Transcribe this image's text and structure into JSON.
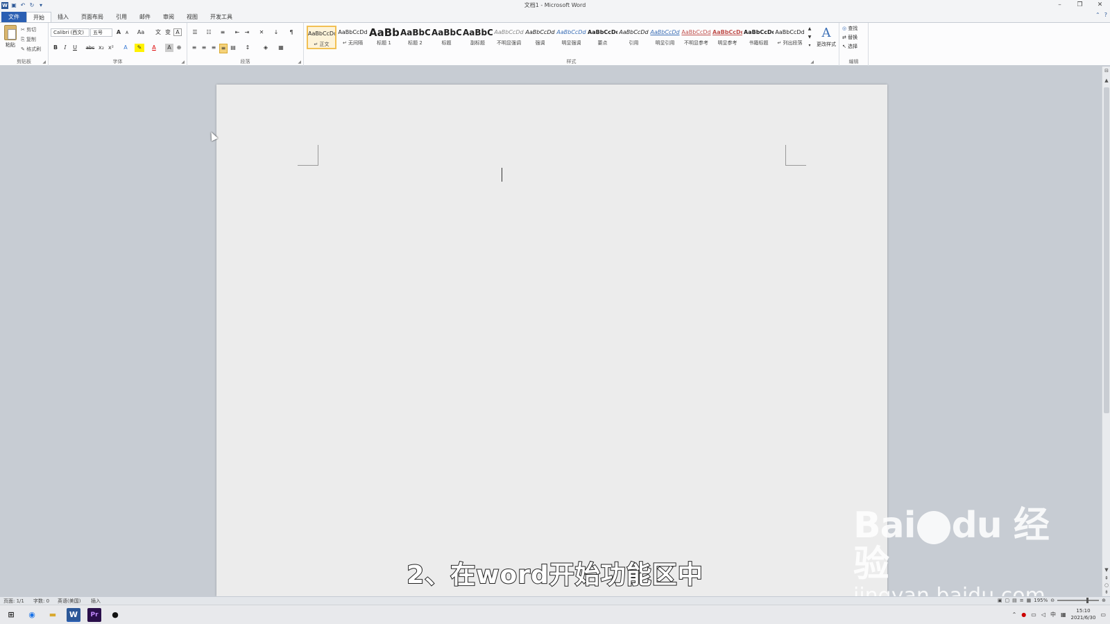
{
  "window": {
    "title": "文档1 - Microsoft Word",
    "minimize": "–",
    "restore": "❐",
    "close": "✕"
  },
  "qat": {
    "word_icon": "W",
    "save_icon": "save-icon",
    "undo_icon": "undo-icon",
    "redo_icon": "redo-icon"
  },
  "tabs": [
    "文件",
    "开始",
    "插入",
    "页面布局",
    "引用",
    "邮件",
    "审阅",
    "视图",
    "开发工具"
  ],
  "clipboard": {
    "paste": "粘贴",
    "cut": "剪切",
    "copy": "复制",
    "painter": "格式刷",
    "label": "剪贴板"
  },
  "font": {
    "name": "Calibri (西文)",
    "size": "五号",
    "bold": "B",
    "italic": "I",
    "underline": "U",
    "strike": "abc",
    "sub": "x₂",
    "sup": "x²",
    "grow": "A",
    "shrink": "A",
    "case": "Aa",
    "label": "字体"
  },
  "paragraph": {
    "label": "段落"
  },
  "styles": {
    "label": "样式",
    "items": [
      {
        "preview": "AaBbCcDd",
        "name": "↵ 正文"
      },
      {
        "preview": "AaBbCcDd",
        "name": "↵ 无间隔"
      },
      {
        "preview": "AaBb",
        "name": "标题 1"
      },
      {
        "preview": "AaBbC",
        "name": "标题 2"
      },
      {
        "preview": "AaBbC",
        "name": "标题"
      },
      {
        "preview": "AaBbC",
        "name": "副标题"
      },
      {
        "preview": "AaBbCcDd",
        "name": "不明显强调"
      },
      {
        "preview": "AaBbCcDd",
        "name": "强调"
      },
      {
        "preview": "AaBbCcDd",
        "name": "明显强调"
      },
      {
        "preview": "AaBbCcDd",
        "name": "要点"
      },
      {
        "preview": "AaBbCcDd",
        "name": "引用"
      },
      {
        "preview": "AaBbCcDd",
        "name": "明显引用"
      },
      {
        "preview": "AaBbCcDd",
        "name": "不明显参考"
      },
      {
        "preview": "AaBbCcDd",
        "name": "明显参考"
      },
      {
        "preview": "AaBbCcDd",
        "name": "书籍标题"
      },
      {
        "preview": "AaBbCcDd",
        "name": "↵ 列出段落"
      }
    ],
    "change_styles": "更改样式",
    "change_icon": "A"
  },
  "editing": {
    "find": "查找",
    "replace": "替换",
    "select": "选择",
    "label": "编辑"
  },
  "status": {
    "page": "页面: 1/1",
    "words": "字数: 0",
    "lang": "英语(美国)",
    "mode": "插入",
    "zoom": "195%"
  },
  "subtitle": "2、在word开始功能区中",
  "watermark": {
    "brand": "Bai",
    "brand2": "du",
    "brand_cn": "经验",
    "url": "jingyan.baidu.com"
  },
  "taskbar": {
    "clock_time": "15:10",
    "clock_date": "2021/6/30",
    "ime": "中",
    "apps": [
      "chrome-icon",
      "folder-icon",
      "word-icon",
      "premiere-icon",
      "media-icon"
    ]
  }
}
